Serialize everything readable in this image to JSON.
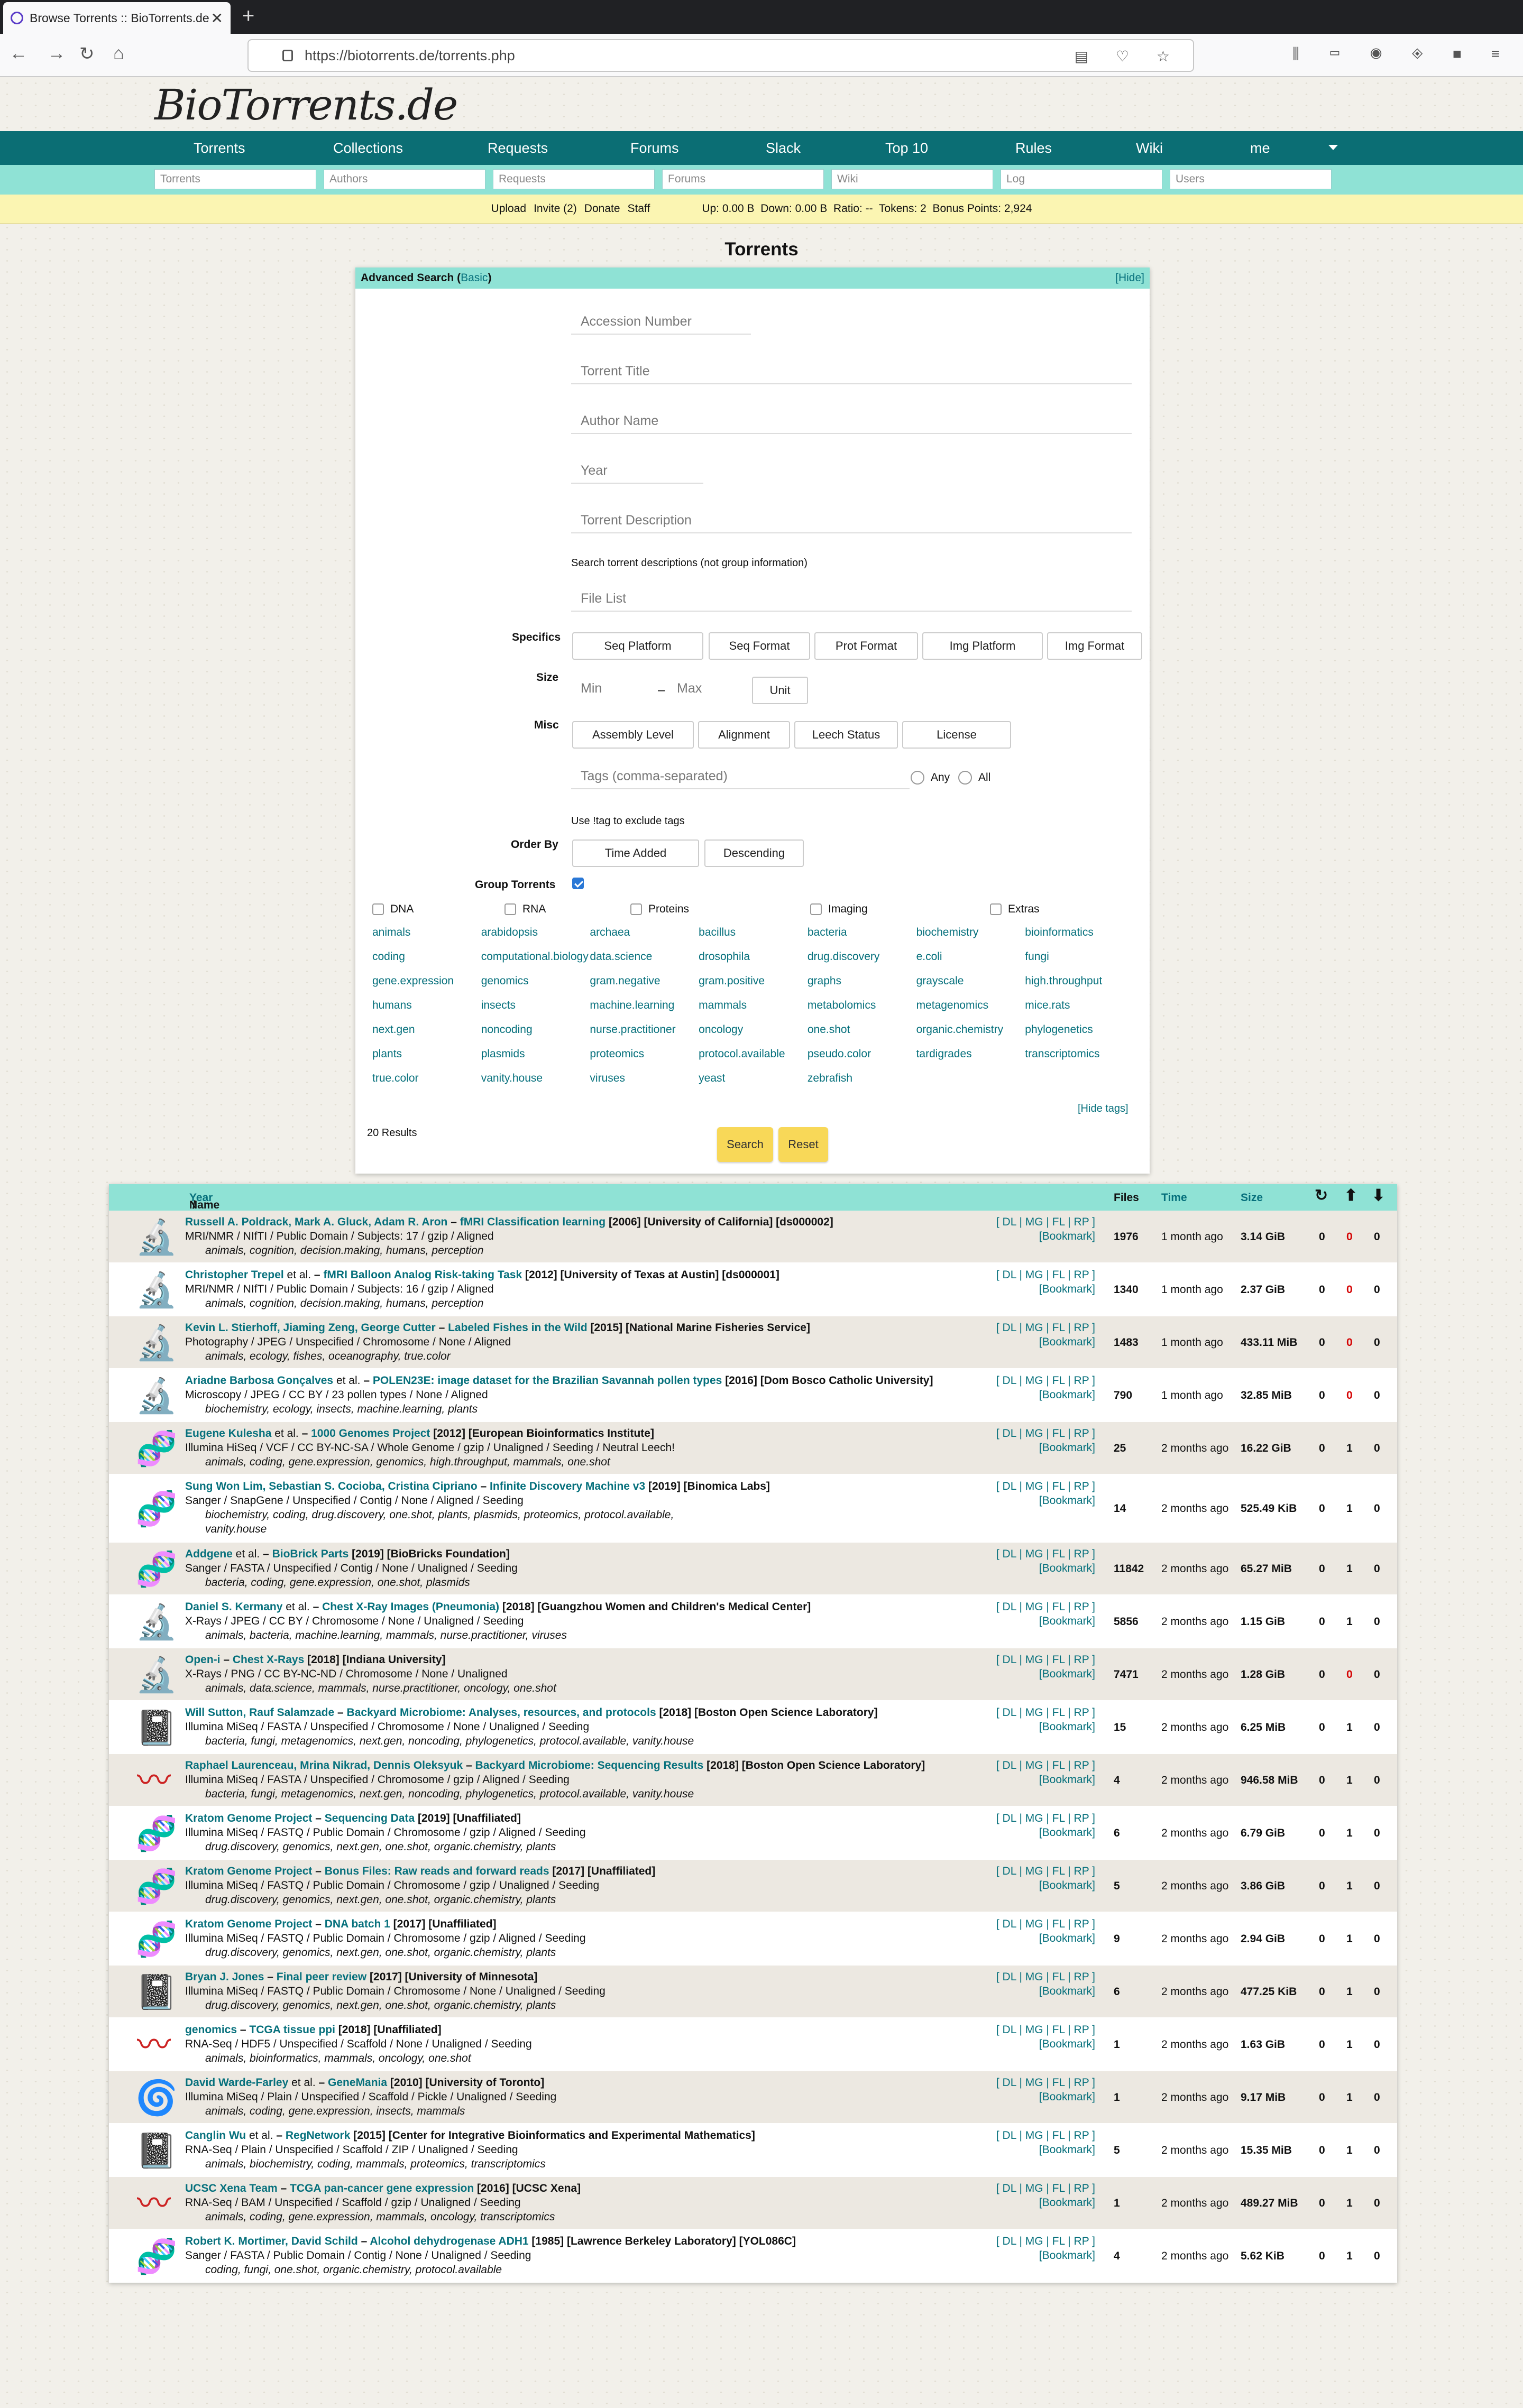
{
  "browser": {
    "tab_title": "Browse Torrents :: BioTorrents.de",
    "url": "https://biotorrents.de/torrents.php"
  },
  "site": {
    "logo": "BioTorrents.de",
    "nav": [
      "Torrents",
      "Collections",
      "Requests",
      "Forums",
      "Slack",
      "Top 10",
      "Rules",
      "Wiki",
      "me"
    ],
    "search_placeholders": [
      "Torrents",
      "Authors",
      "Requests",
      "Forums",
      "Wiki",
      "Log",
      "Users"
    ],
    "status": {
      "upload": "Upload",
      "invite": "Invite (2)",
      "donate": "Donate",
      "staff": "Staff",
      "stats": "Up: 0.00 B  Down: 0.00 B  Ratio: --  Tokens: 2  Bonus Points: 2,924"
    }
  },
  "page_title": "Torrents",
  "adv": {
    "title": "Advanced Search (",
    "basic": "Basic",
    "title_end": ")",
    "hide": "[Hide]",
    "fields": {
      "accession": "Accession Number",
      "title": "Torrent Title",
      "author": "Author Name",
      "year": "Year",
      "description": "Torrent Description",
      "desc_note": "Search torrent descriptions (not group information)",
      "filelist": "File List",
      "min": "Min",
      "dash": "–",
      "max": "Max",
      "tags": "Tags (comma-separated)",
      "tag_note": "Use !tag to exclude tags"
    },
    "labels": {
      "specifics": "Specifics",
      "size": "Size",
      "misc": "Misc",
      "order": "Order By",
      "group": "Group Torrents"
    },
    "specifics": [
      "Seq Platform",
      "Seq Format",
      "Prot Format",
      "Img Platform",
      "Img Format"
    ],
    "unit": "Unit",
    "misc": [
      "Assembly Level",
      "Alignment",
      "Leech Status",
      "License"
    ],
    "any": "Any",
    "all": "All",
    "order": [
      "Time Added",
      "Descending"
    ],
    "categories": [
      "DNA",
      "RNA",
      "Proteins",
      "Imaging",
      "Extras"
    ],
    "tags": [
      "animals",
      "arabidopsis",
      "archaea",
      "bacillus",
      "bacteria",
      "biochemistry",
      "bioinformatics",
      "coding",
      "computational.biology",
      "data.science",
      "drosophila",
      "drug.discovery",
      "e.coli",
      "fungi",
      "gene.expression",
      "genomics",
      "gram.negative",
      "gram.positive",
      "graphs",
      "grayscale",
      "high.throughput",
      "humans",
      "insects",
      "machine.learning",
      "mammals",
      "metabolomics",
      "metagenomics",
      "mice.rats",
      "next.gen",
      "noncoding",
      "nurse.practitioner",
      "oncology",
      "one.shot",
      "organic.chemistry",
      "phylogenetics",
      "plants",
      "plasmids",
      "proteomics",
      "protocol.available",
      "pseudo.color",
      "tardigrades",
      "transcriptomics",
      "true.color",
      "vanity.house",
      "viruses",
      "yeast",
      "zebrafish"
    ],
    "hide_tags": "[Hide tags]",
    "results": "20 Results",
    "search": "Search",
    "reset": "Reset"
  },
  "table": {
    "name": "Name",
    "slash": " / ",
    "year": "Year",
    "files": "Files",
    "time": "Time",
    "size": "Size",
    "acts": "[ DL | MG | FL | RP ]",
    "bookmark": "[Bookmark]",
    "rows": [
      {
        "icon": "microscope",
        "authors": "Russell A. Poldrack, Mark A. Gluck, Adam R. Aron",
        "sep": " – ",
        "title": "fMRI Classification learning",
        "rest": " [2006] [University of California] [ds000002]",
        "meta": "MRI/NMR / NIfTI / Public Domain / Subjects: 17 / gzip / Aligned",
        "tags": "animals, cognition, decision.making, humans, perception",
        "files": "1976",
        "time": "1 month ago",
        "size": "3.14 GiB",
        "s": "0",
        "l": "0",
        "c": "0",
        "lred": true
      },
      {
        "icon": "microscope",
        "authors": "Christopher Trepel",
        "etal": " et al.",
        "sep": " – ",
        "title": "fMRI Balloon Analog Risk-taking Task",
        "rest": " [2012] [University of Texas at Austin] [ds000001]",
        "meta": "MRI/NMR / NIfTI / Public Domain / Subjects: 16 / gzip / Aligned",
        "tags": "animals, cognition, decision.making, humans, perception",
        "files": "1340",
        "time": "1 month ago",
        "size": "2.37 GiB",
        "s": "0",
        "l": "0",
        "c": "0",
        "lred": true
      },
      {
        "icon": "microscope",
        "authors": "Kevin L. Stierhoff, Jiaming Zeng, George Cutter",
        "sep": " – ",
        "title": "Labeled Fishes in the Wild",
        "rest": " [2015] [National Marine Fisheries Service]",
        "meta": "Photography / JPEG / Unspecified / Chromosome / None / Aligned",
        "tags": "animals, ecology, fishes, oceanography, true.color",
        "files": "1483",
        "time": "1 month ago",
        "size": "433.11 MiB",
        "s": "0",
        "l": "0",
        "c": "0",
        "lred": true
      },
      {
        "icon": "microscope",
        "authors": "Ariadne Barbosa Gonçalves",
        "etal": " et al.",
        "sep": " – ",
        "title": "POLEN23E: image dataset for the Brazilian Savannah pollen types",
        "rest": " [2016] [Dom Bosco Catholic University]",
        "meta": "Microscopy / JPEG / CC BY / 23 pollen types / None / Aligned",
        "tags": "biochemistry, ecology, insects, machine.learning, plants",
        "files": "790",
        "time": "1 month ago",
        "size": "32.85 MiB",
        "s": "0",
        "l": "0",
        "c": "0",
        "lred": true
      },
      {
        "icon": "dna",
        "authors": "Eugene Kulesha",
        "etal": " et al.",
        "sep": " – ",
        "title": "1000 Genomes Project",
        "rest": " [2012] [European Bioinformatics Institute]",
        "meta": "Illumina HiSeq / VCF / CC BY-NC-SA / Whole Genome / gzip / Unaligned / Seeding / Neutral Leech!",
        "tags": "animals, coding, gene.expression, genomics, high.throughput, mammals, one.shot",
        "files": "25",
        "time": "2 months ago",
        "size": "16.22 GiB",
        "s": "0",
        "l": "1",
        "c": "0"
      },
      {
        "icon": "dna",
        "authors": "Sung Won Lim, Sebastian S. Cocioba, Cristina Cipriano",
        "sep": " – ",
        "title": "Infinite Discovery Machine v3",
        "rest": " [2019] [Binomica Labs]",
        "meta": "Sanger / SnapGene / Unspecified / Contig / None / Aligned / Seeding",
        "tags": "biochemistry, coding, drug.discovery, one.shot, plants, plasmids, proteomics, protocol.available,",
        "tags2": "vanity.house",
        "files": "14",
        "time": "2 months ago",
        "size": "525.49 KiB",
        "s": "0",
        "l": "1",
        "c": "0",
        "tall": true
      },
      {
        "icon": "dna",
        "authors": "Addgene",
        "etal": " et al.",
        "sep": " – ",
        "title": "BioBrick Parts",
        "rest": " [2019] [BioBricks Foundation]",
        "meta": "Sanger / FASTA / Unspecified / Contig / None / Unaligned / Seeding",
        "tags": "bacteria, coding, gene.expression, one.shot, plasmids",
        "files": "11842",
        "time": "2 months ago",
        "size": "65.27 MiB",
        "s": "0",
        "l": "1",
        "c": "0"
      },
      {
        "icon": "microscope",
        "authors": "Daniel S. Kermany",
        "etal": " et al.",
        "sep": " – ",
        "title": "Chest X-Ray Images (Pneumonia)",
        "rest": " [2018] [Guangzhou Women and Children's Medical Center]",
        "meta": "X-Rays / JPEG / CC BY / Chromosome / None / Unaligned / Seeding",
        "tags": "animals, bacteria, machine.learning, mammals, nurse.practitioner, viruses",
        "files": "5856",
        "time": "2 months ago",
        "size": "1.15 GiB",
        "s": "0",
        "l": "1",
        "c": "0"
      },
      {
        "icon": "microscope",
        "authors": "Open-i",
        "sep": " – ",
        "title": "Chest X-Rays",
        "rest": " [2018] [Indiana University]",
        "meta": "X-Rays / PNG / CC BY-NC-ND / Chromosome / None / Unaligned",
        "tags": "animals, data.science, mammals, nurse.practitioner, oncology, one.shot",
        "files": "7471",
        "time": "2 months ago",
        "size": "1.28 GiB",
        "s": "0",
        "l": "0",
        "c": "0",
        "lred": true
      },
      {
        "icon": "book",
        "authors": "Will Sutton, Rauf Salamzade",
        "sep": " – ",
        "title": "Backyard Microbiome: Analyses, resources, and protocols",
        "rest": " [2018] [Boston Open Science Laboratory]",
        "meta": "Illumina MiSeq / FASTA / Unspecified / Chromosome / None / Unaligned / Seeding",
        "tags": "bacteria, fungi, metagenomics, next.gen, noncoding, phylogenetics, protocol.available, vanity.house",
        "files": "15",
        "time": "2 months ago",
        "size": "6.25 MiB",
        "s": "0",
        "l": "1",
        "c": "0"
      },
      {
        "icon": "rna",
        "authors": "Raphael Laurenceau, Mrina Nikrad, Dennis Oleksyuk",
        "sep": " – ",
        "title": "Backyard Microbiome: Sequencing Results",
        "rest": " [2018] [Boston Open Science Laboratory]",
        "meta": "Illumina MiSeq / FASTA / Unspecified / Chromosome / gzip / Aligned / Seeding",
        "tags": "bacteria, fungi, metagenomics, next.gen, noncoding, phylogenetics, protocol.available, vanity.house",
        "files": "4",
        "time": "2 months ago",
        "size": "946.58 MiB",
        "s": "0",
        "l": "1",
        "c": "0"
      },
      {
        "icon": "dna",
        "authors": "Kratom Genome Project",
        "sep": " – ",
        "title": "Sequencing Data",
        "rest": " [2019] [Unaffiliated]",
        "meta": "Illumina MiSeq / FASTQ / Public Domain / Chromosome / gzip / Aligned / Seeding",
        "tags": "drug.discovery, genomics, next.gen, one.shot, organic.chemistry, plants",
        "files": "6",
        "time": "2 months ago",
        "size": "6.79 GiB",
        "s": "0",
        "l": "1",
        "c": "0"
      },
      {
        "icon": "dna",
        "authors": "Kratom Genome Project",
        "sep": " – ",
        "title": "Bonus Files: Raw reads and forward reads",
        "rest": " [2017] [Unaffiliated]",
        "meta": "Illumina MiSeq / FASTQ / Public Domain / Chromosome / gzip / Unaligned / Seeding",
        "tags": "drug.discovery, genomics, next.gen, one.shot, organic.chemistry, plants",
        "files": "5",
        "time": "2 months ago",
        "size": "3.86 GiB",
        "s": "0",
        "l": "1",
        "c": "0"
      },
      {
        "icon": "dna",
        "authors": "Kratom Genome Project",
        "sep": " – ",
        "title": "DNA batch 1",
        "rest": " [2017] [Unaffiliated]",
        "meta": "Illumina MiSeq / FASTQ / Public Domain / Chromosome / gzip / Aligned / Seeding",
        "tags": "drug.discovery, genomics, next.gen, one.shot, organic.chemistry, plants",
        "files": "9",
        "time": "2 months ago",
        "size": "2.94 GiB",
        "s": "0",
        "l": "1",
        "c": "0"
      },
      {
        "icon": "book",
        "authors": "Bryan J. Jones",
        "sep": " – ",
        "title": "Final peer review",
        "rest": " [2017] [University of Minnesota]",
        "meta": "Illumina MiSeq / FASTQ / Public Domain / Chromosome / None / Unaligned / Seeding",
        "tags": "drug.discovery, genomics, next.gen, one.shot, organic.chemistry, plants",
        "files": "6",
        "time": "2 months ago",
        "size": "477.25 KiB",
        "s": "0",
        "l": "1",
        "c": "0"
      },
      {
        "icon": "rna",
        "authors": "genomics",
        "sep": " – ",
        "title": "TCGA tissue ppi",
        "rest": " [2018] [Unaffiliated]",
        "meta": "RNA-Seq / HDF5 / Unspecified / Scaffold / None / Unaligned / Seeding",
        "tags": "animals, bioinformatics, mammals, oncology, one.shot",
        "files": "1",
        "time": "2 months ago",
        "size": "1.63 GiB",
        "s": "0",
        "l": "1",
        "c": "0"
      },
      {
        "icon": "protein",
        "authors": "David Warde-Farley",
        "etal": " et al.",
        "sep": " – ",
        "title": "GeneMania",
        "rest": " [2010] [University of Toronto]",
        "meta": "Illumina MiSeq / Plain / Unspecified / Scaffold / Pickle / Unaligned / Seeding",
        "tags": "animals, coding, gene.expression, insects, mammals",
        "files": "1",
        "time": "2 months ago",
        "size": "9.17 MiB",
        "s": "0",
        "l": "1",
        "c": "0"
      },
      {
        "icon": "book",
        "authors": "Canglin Wu",
        "etal": " et al.",
        "sep": " – ",
        "title": "RegNetwork",
        "rest": " [2015] [Center for Integrative Bioinformatics and Experimental Mathematics]",
        "meta": "RNA-Seq / Plain / Unspecified / Scaffold / ZIP / Unaligned / Seeding",
        "tags": "animals, biochemistry, coding, mammals, proteomics, transcriptomics",
        "files": "5",
        "time": "2 months ago",
        "size": "15.35 MiB",
        "s": "0",
        "l": "1",
        "c": "0"
      },
      {
        "icon": "rna",
        "authors": "UCSC Xena Team",
        "sep": " – ",
        "title": "TCGA pan-cancer gene expression",
        "rest": " [2016] [UCSC Xena]",
        "meta": "RNA-Seq / BAM / Unspecified / Scaffold / gzip / Unaligned / Seeding",
        "tags": "animals, coding, gene.expression, mammals, oncology, transcriptomics",
        "files": "1",
        "time": "2 months ago",
        "size": "489.27 MiB",
        "s": "0",
        "l": "1",
        "c": "0"
      },
      {
        "icon": "dna",
        "authors": "Robert K. Mortimer, David Schild",
        "sep": " – ",
        "title": "Alcohol dehydrogenase ADH1",
        "rest": " [1985] [Lawrence Berkeley Laboratory] [YOL086C]",
        "meta": "Sanger / FASTA / Public Domain / Contig / None / Unaligned / Seeding",
        "tags": "coding, fungi, one.shot, organic.chemistry, protocol.available",
        "files": "4",
        "time": "2 months ago",
        "size": "5.62 KiB",
        "s": "0",
        "l": "1",
        "c": "0"
      }
    ]
  }
}
